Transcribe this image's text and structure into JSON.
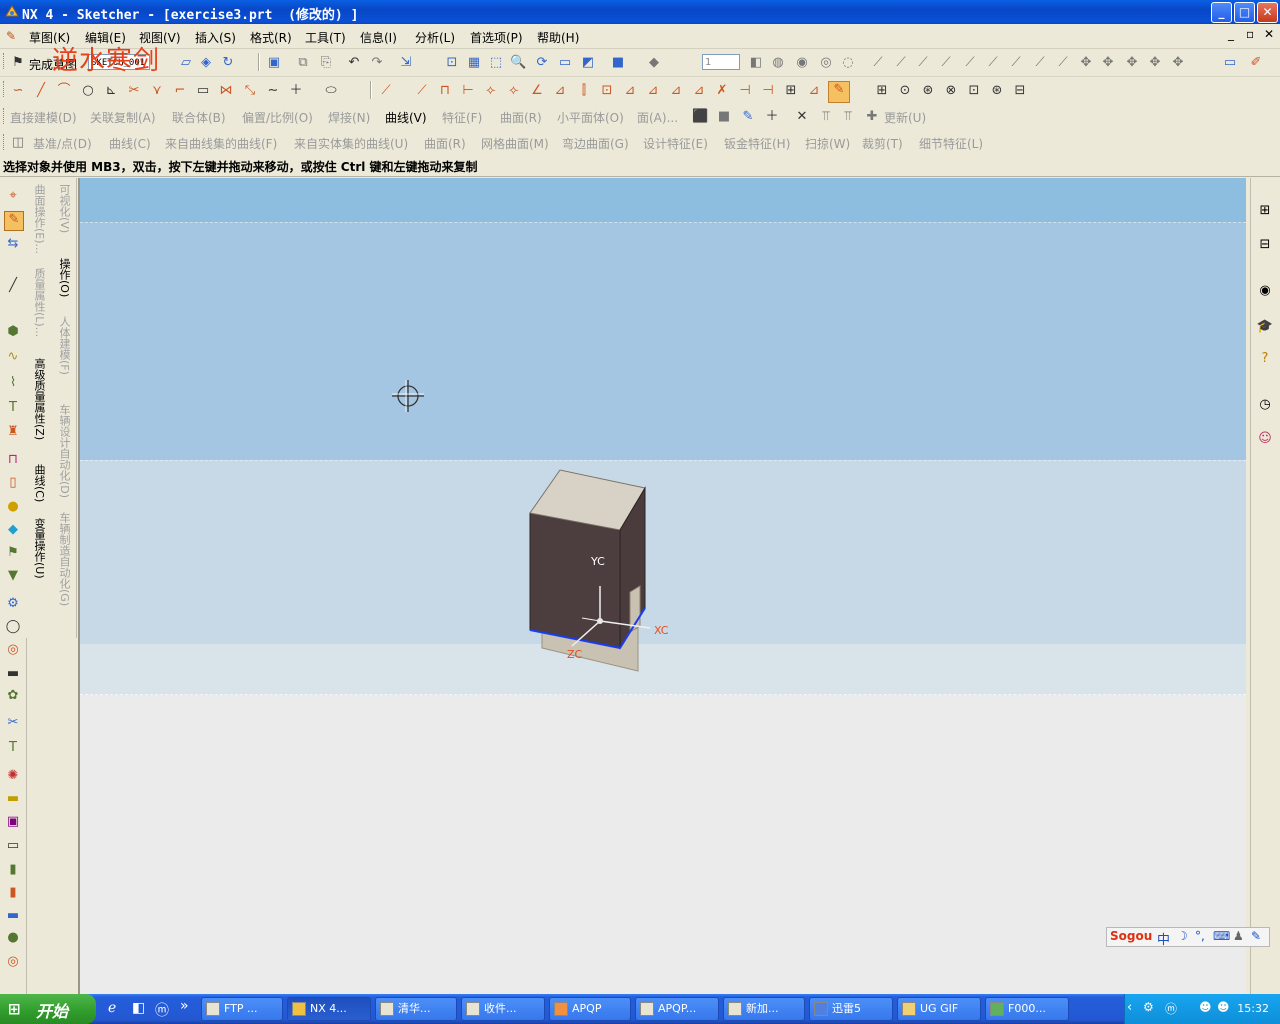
{
  "window": {
    "title": "NX 4 - Sketcher - [exercise3.prt  (修改的) ]",
    "minimize": "_",
    "maximize": "□",
    "close": "✕"
  },
  "menu": {
    "items": [
      "草图(K)",
      "编辑(E)",
      "视图(V)",
      "插入(S)",
      "格式(R)",
      "工具(T)",
      "信息(I)",
      "分析(L)",
      "首选项(P)",
      "帮助(H)"
    ],
    "doc_controls": [
      "_",
      "▫",
      "✕"
    ]
  },
  "watermark": "逆水寒剑",
  "sketch_toolbar": {
    "finish_label": "完成草图",
    "sketch_name": "SKETCH_001",
    "layer_value": "1"
  },
  "feature_toolbar": {
    "items": [
      "直接建模(D)",
      "关联复制(A)",
      "联合体(B)",
      "偏置/比例(O)",
      "焊接(N)",
      "曲线(V)",
      "特征(F)",
      "曲面(R)",
      "小平面体(O)",
      "面(A)...",
      "更新(U)"
    ]
  },
  "curve_toolbar": {
    "items": [
      "基准/点(D)",
      "曲线(C)",
      "来自曲线集的曲线(F)",
      "来自实体集的曲线(U)",
      "曲面(R)",
      "网格曲面(M)",
      "弯边曲面(G)",
      "设计特征(E)",
      "钣金特征(H)",
      "扫掠(W)",
      "裁剪(T)",
      "细节特征(L)"
    ]
  },
  "status": {
    "prompt": "选择对象并使用 MB3，双击，按下左键并拖动来移动，或按住 Ctrl 键和左键拖动来复制"
  },
  "resource_tabs": {
    "col1": [
      "曲面操作(E)...",
      "质量属性(L)...",
      "高级质量属性(Z)",
      "曲线(C)",
      "变量操作(U)"
    ],
    "col2": [
      "可视化(V)",
      "操作(O)",
      "人体建模(F)",
      "车辆设计自动化(D)",
      "车辆制造自动化(G)"
    ]
  },
  "viewport": {
    "axes": {
      "x": "XC",
      "y": "YC",
      "z": "ZC"
    }
  },
  "ime": {
    "brand": "Sogou",
    "mode": "中"
  },
  "taskbar": {
    "start": "开始",
    "tasks": [
      "FTP ...",
      "NX 4...",
      "清华...",
      "收件...",
      "APQP",
      "APQP...",
      "新加...",
      "迅雷5",
      "UG GIF",
      "F000..."
    ],
    "active_task": 1,
    "clock": "15:32"
  }
}
